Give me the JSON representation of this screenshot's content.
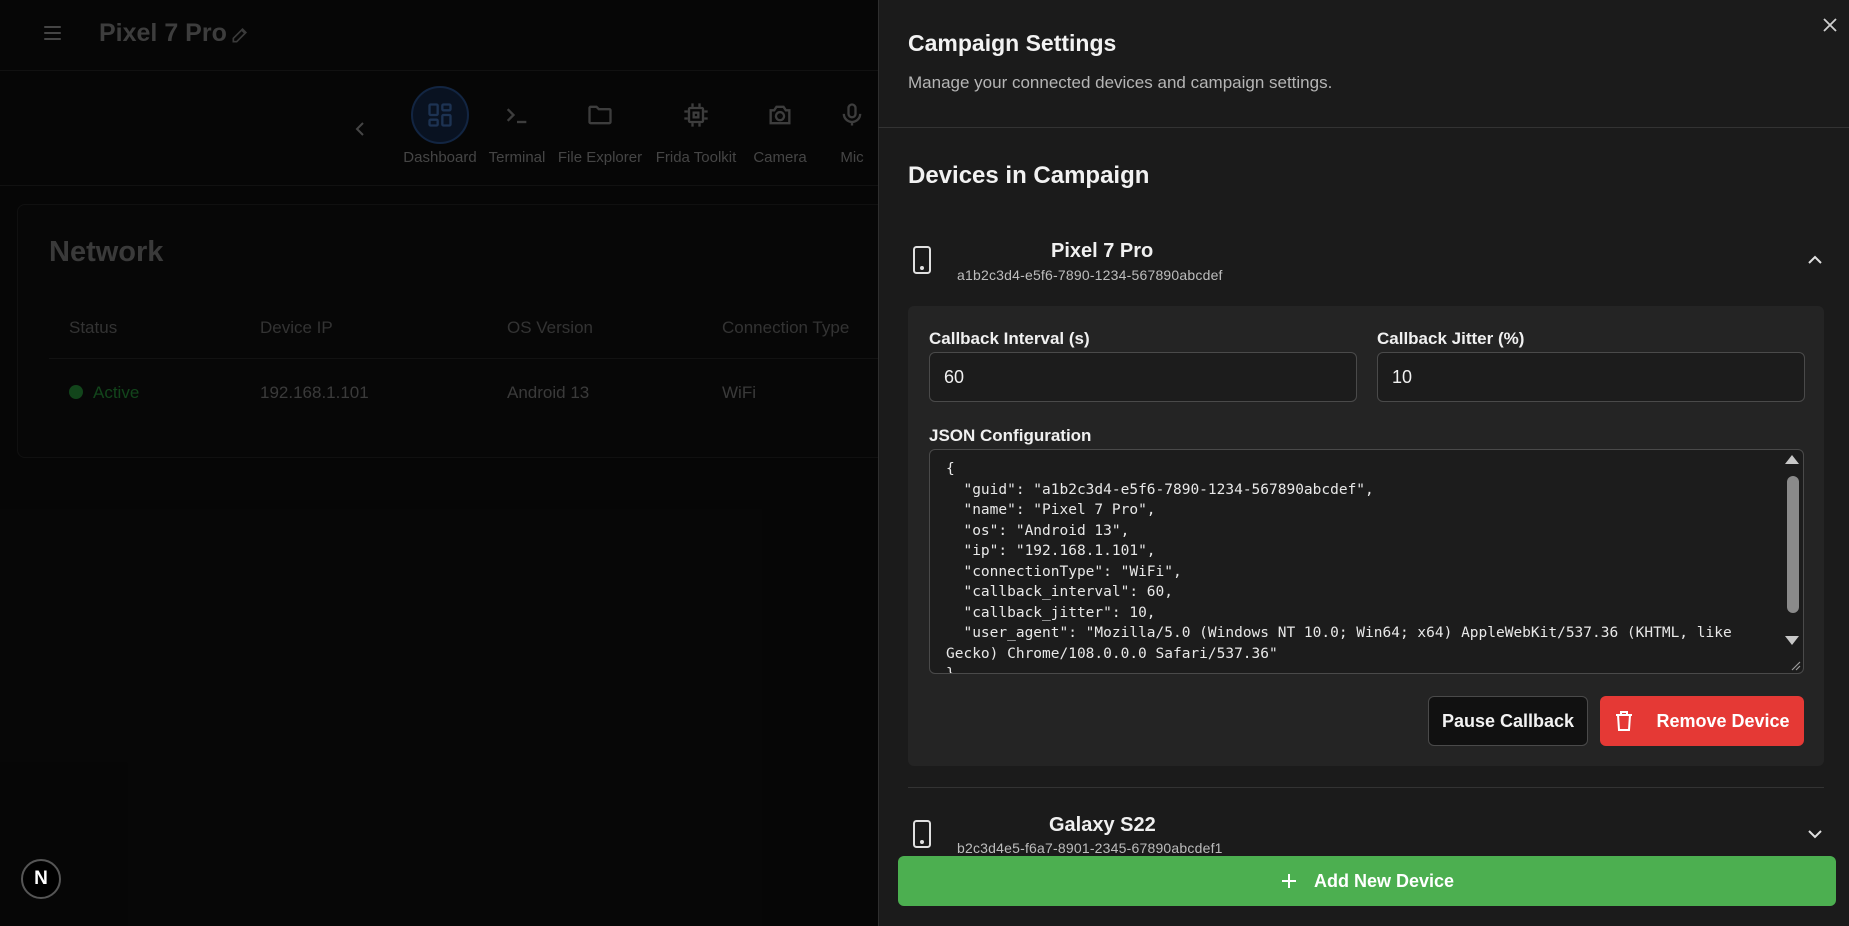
{
  "app": {
    "title": "Pixel 7 Pro",
    "nav_items": [
      {
        "label": "Dashboard",
        "icon": "dashboard-icon",
        "active": true
      },
      {
        "label": "Terminal",
        "icon": "terminal-icon"
      },
      {
        "label": "File Explorer",
        "icon": "folder-icon"
      },
      {
        "label": "Frida Toolkit",
        "icon": "chip-icon"
      },
      {
        "label": "Camera",
        "icon": "camera-icon"
      },
      {
        "label": "Mic",
        "icon": "mic-icon"
      }
    ],
    "network": {
      "title": "Network",
      "columns": [
        "Status",
        "Device IP",
        "OS Version",
        "Connection Type"
      ],
      "row": {
        "status": "Active",
        "ip": "192.168.1.101",
        "os": "Android 13",
        "connection": "WiFi"
      }
    },
    "badge_letter": "N"
  },
  "panel": {
    "title": "Campaign Settings",
    "subtitle": "Manage your connected devices and campaign settings.",
    "section_title": "Devices in Campaign",
    "devices": [
      {
        "name": "Pixel 7 Pro",
        "guid": "a1b2c3d4-e5f6-7890-1234-567890abcdef",
        "expanded": true,
        "interval_label": "Callback Interval (s)",
        "interval_value": "60",
        "jitter_label": "Callback Jitter (%)",
        "jitter_value": "10",
        "json_label": "JSON Configuration",
        "json_text": "{\n  \"guid\": \"a1b2c3d4-e5f6-7890-1234-567890abcdef\",\n  \"name\": \"Pixel 7 Pro\",\n  \"os\": \"Android 13\",\n  \"ip\": \"192.168.1.101\",\n  \"connectionType\": \"WiFi\",\n  \"callback_interval\": 60,\n  \"callback_jitter\": 10,\n  \"user_agent\": \"Mozilla/5.0 (Windows NT 10.0; Win64; x64) AppleWebKit/537.36 (KHTML, like Gecko) Chrome/108.0.0.0 Safari/537.36\"\n}",
        "pause_label": "Pause Callback",
        "remove_label": "Remove Device"
      },
      {
        "name": "Galaxy S22",
        "guid": "b2c3d4e5-f6a7-8901-2345-67890abcdef1",
        "expanded": false
      }
    ],
    "add_label": "Add New Device"
  },
  "colors": {
    "danger": "#e53935",
    "success": "#4caf50",
    "active_status": "#1c6b2a"
  }
}
